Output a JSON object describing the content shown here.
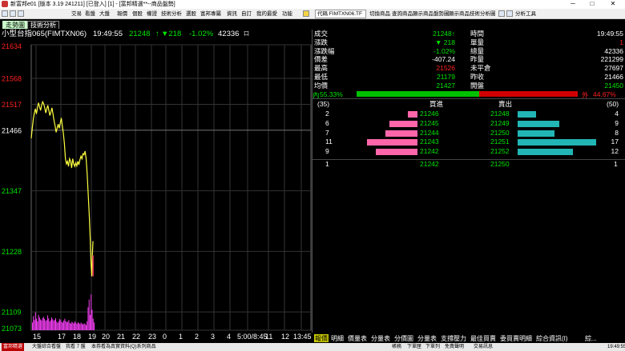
{
  "window": {
    "title": "新富邦e01 [版本 3.19 241211] [已登入] [1] - [富邦精選**--商品盤勢]",
    "minimize": "─",
    "maximize": "□",
    "close": "✕"
  },
  "menu": {
    "items": [
      "交易",
      "看盤",
      "大盤",
      "報價",
      "個股",
      "權證",
      "技術分析",
      "選股",
      "富邦專屬",
      "資訊",
      "自訂",
      "我的最愛",
      "功能"
    ],
    "code_value": "代碼 FIMTXN06.TF",
    "right_items": [
      "切換商品",
      "查詢商品",
      "顯示商品盤勢圖",
      "顯示商品技術分析圖"
    ],
    "analysis_tools": "分析工具"
  },
  "tabs": [
    {
      "label": "走勢圖",
      "active": true
    },
    {
      "label": "技術分析",
      "active": false
    }
  ],
  "info": {
    "instrument": "小型台指065(FIMTXN06)",
    "time": "19:49:55",
    "price": "21248",
    "price_arrow": "↑",
    "change": "▼218",
    "change_pct": "-1.02%",
    "volume": "42336",
    "volume_suffix": "口"
  },
  "quote": {
    "rows": [
      {
        "l1": "成交",
        "v1": "21248↑",
        "c1": "green",
        "l2": "時間",
        "v2": "19:49:55",
        "c2": "white"
      },
      {
        "l1": "漲跌",
        "v1": "▼  218",
        "c1": "green",
        "l2": "單量",
        "v2": "1",
        "c2": "red"
      },
      {
        "l1": "漲跌幅",
        "v1": "-1.02%",
        "c1": "green",
        "l2": "總量",
        "v2": "42336",
        "c2": "white"
      },
      {
        "l1": "價差",
        "v1": "-407.24",
        "c1": "white",
        "l2": "昨量",
        "v2": "221299",
        "c2": "white"
      },
      {
        "l1": "最高",
        "v1": "21526",
        "c1": "red",
        "l2": "未平倉",
        "v2": "27697",
        "c2": "white"
      },
      {
        "l1": "最低",
        "v1": "21179",
        "c1": "green",
        "l2": "昨收",
        "v2": "21466",
        "c2": "white"
      },
      {
        "l1": "均價",
        "v1": "21427",
        "c1": "green",
        "l2": "開盤",
        "v2": "21450",
        "c2": "green"
      }
    ]
  },
  "ratio": {
    "inner_label": "內",
    "inner_pct": "55.33%",
    "inner_value": 55.33,
    "outer_label": "外",
    "outer_pct": "44.67%",
    "outer_value": 44.67
  },
  "book": {
    "bid_total": "(35)",
    "ask_total": "(50)",
    "bid_header": "買進",
    "ask_header": "賣出",
    "max_qty": 17,
    "rows": [
      {
        "bid_qty": "2",
        "bid_qty_n": 2,
        "bid_price": "21246",
        "ask_price": "21248",
        "ask_qty": "4",
        "ask_qty_n": 4
      },
      {
        "bid_qty": "6",
        "bid_qty_n": 6,
        "bid_price": "21245",
        "ask_price": "21249",
        "ask_qty": "9",
        "ask_qty_n": 9
      },
      {
        "bid_qty": "7",
        "bid_qty_n": 7,
        "bid_price": "21244",
        "ask_price": "21250",
        "ask_qty": "8",
        "ask_qty_n": 8
      },
      {
        "bid_qty": "11",
        "bid_qty_n": 11,
        "bid_price": "21243",
        "ask_price": "21251",
        "ask_qty": "17",
        "ask_qty_n": 17
      },
      {
        "bid_qty": "9",
        "bid_qty_n": 9,
        "bid_price": "21242",
        "ask_price": "21252",
        "ask_qty": "12",
        "ask_qty_n": 12
      }
    ],
    "last": {
      "bid_qty": "1",
      "bid_price": "21242",
      "ask_price": "21250",
      "ask_qty": "1"
    }
  },
  "chart_data": {
    "type": "line",
    "y_ticks": [
      {
        "label": "21634",
        "value": 21634,
        "color": "#ff2020"
      },
      {
        "label": "21568",
        "value": 21568,
        "color": "#ff2020"
      },
      {
        "label": "21517",
        "value": 21517,
        "color": "#ff2020"
      },
      {
        "label": "21466",
        "value": 21466,
        "color": "#ffffff"
      },
      {
        "label": "21347",
        "value": 21347,
        "color": "#00e600"
      },
      {
        "label": "21228",
        "value": 21228,
        "color": "#00e600"
      },
      {
        "label": "21109",
        "value": 21109,
        "color": "#00e600"
      },
      {
        "label": "21073",
        "value": 21073,
        "color": "#00e600"
      }
    ],
    "ylim": [
      21073,
      21634
    ],
    "reference": 21466,
    "x_ticks": [
      "15",
      "17",
      "18",
      "19",
      "20",
      "21",
      "22",
      "23",
      "0",
      "1",
      "2",
      "3",
      "4",
      "5:00/8:45",
      "11",
      "12",
      "13:45"
    ],
    "price_series": [
      [
        0.0,
        21450
      ],
      [
        0.05,
        21470
      ],
      [
        0.1,
        21488
      ],
      [
        0.15,
        21500
      ],
      [
        0.2,
        21508
      ],
      [
        0.25,
        21498
      ],
      [
        0.3,
        21510
      ],
      [
        0.35,
        21520
      ],
      [
        0.4,
        21512
      ],
      [
        0.45,
        21505
      ],
      [
        0.5,
        21515
      ],
      [
        0.55,
        21522
      ],
      [
        0.6,
        21518
      ],
      [
        0.65,
        21510
      ],
      [
        0.7,
        21500
      ],
      [
        0.75,
        21508
      ],
      [
        0.8,
        21515
      ],
      [
        0.85,
        21505
      ],
      [
        0.9,
        21495
      ],
      [
        0.95,
        21502
      ],
      [
        1.0,
        21510
      ],
      [
        1.05,
        21498
      ],
      [
        1.1,
        21485
      ],
      [
        1.15,
        21475
      ],
      [
        1.2,
        21462
      ],
      [
        1.25,
        21470
      ],
      [
        1.3,
        21478
      ],
      [
        1.35,
        21470
      ],
      [
        1.4,
        21480
      ],
      [
        1.45,
        21490
      ],
      [
        1.5,
        21475
      ],
      [
        1.55,
        21460
      ],
      [
        1.6,
        21440
      ],
      [
        1.65,
        21410
      ],
      [
        1.7,
        21400
      ],
      [
        1.75,
        21405
      ],
      [
        1.8,
        21395
      ],
      [
        1.85,
        21410
      ],
      [
        1.9,
        21405
      ],
      [
        1.95,
        21392
      ],
      [
        2.0,
        21410
      ],
      [
        2.05,
        21400
      ],
      [
        2.1,
        21395
      ],
      [
        2.15,
        21402
      ],
      [
        2.2,
        21396
      ],
      [
        2.25,
        21405
      ],
      [
        2.3,
        21398
      ],
      [
        2.35,
        21408
      ],
      [
        2.4,
        21415
      ],
      [
        2.45,
        21410
      ],
      [
        2.5,
        21420
      ],
      [
        2.55,
        21418
      ],
      [
        2.6,
        21425
      ],
      [
        2.65,
        21410
      ],
      [
        2.7,
        21380
      ],
      [
        2.75,
        21340
      ],
      [
        2.8,
        21300
      ],
      [
        2.85,
        21250
      ],
      [
        2.88,
        21210
      ],
      [
        2.92,
        21179
      ],
      [
        2.95,
        21220
      ],
      [
        2.98,
        21248
      ]
    ],
    "volume_series": [
      30,
      55,
      40,
      70,
      45,
      35,
      60,
      50,
      42,
      38,
      48,
      52,
      44,
      36,
      40,
      58,
      46,
      34,
      39,
      50,
      43,
      37,
      41,
      47,
      33,
      29,
      35,
      44,
      40,
      32,
      30,
      38,
      45,
      36,
      31,
      34,
      40,
      28,
      26,
      33,
      30,
      27,
      35,
      29,
      25,
      31,
      28,
      24,
      30,
      26,
      22,
      27,
      25,
      20,
      35,
      90,
      120,
      60,
      140,
      80,
      45,
      30
    ],
    "x_max": 13.5
  },
  "xaxis": {
    "labels": [
      "15",
      "17",
      "18",
      "19",
      "20",
      "21",
      "22",
      "23",
      "0",
      "1",
      "2",
      "3",
      "4",
      "5:00/8:45",
      "11",
      "12",
      "13:45"
    ]
  },
  "bottom_tabs": [
    "報價",
    "明細",
    "價量表",
    "分量表",
    "分價圖",
    "分量表",
    "支撐壓力",
    "最佳買賣",
    "委買賣明細",
    "綜合資訊(I)",
    "綜..."
  ],
  "status": {
    "items": [
      "富邦精選",
      "大盤綜合看盤",
      "我看 7 盤",
      "本券看為真實資料(Q)系列商品"
    ],
    "right_items": [
      "回報系統",
      "帳務",
      "下單匣",
      "下單列",
      "免責聲明",
      "交易訊息",
      "19:49:55"
    ]
  },
  "colors": {
    "up": "#ff2020",
    "down": "#00e600",
    "price_line": "#ffff40",
    "volume": "#ff40ff",
    "bid_bar": "#ff66aa",
    "ask_bar": "#22b5b5",
    "inner_bar": "#00c000",
    "outer_bar": "#d00000"
  }
}
